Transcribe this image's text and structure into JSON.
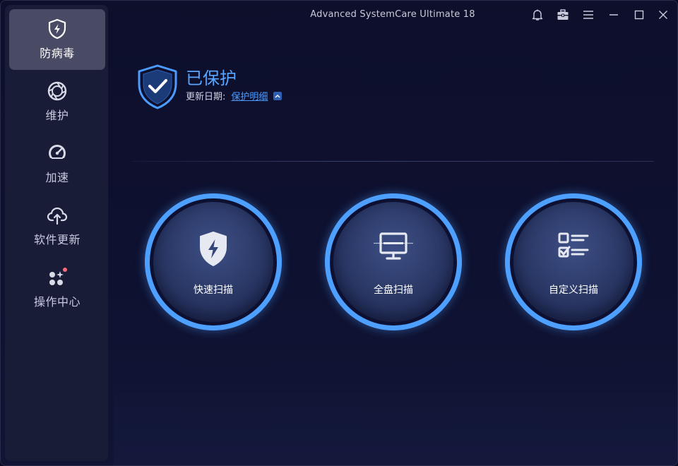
{
  "window": {
    "title": "Advanced SystemCare Ultimate  18"
  },
  "titlebar": {
    "buttons": [
      {
        "name": "bell-icon"
      },
      {
        "name": "toolbox-icon"
      },
      {
        "name": "menu-icon"
      },
      {
        "name": "minimize-icon"
      },
      {
        "name": "maximize-icon"
      },
      {
        "name": "close-icon"
      }
    ]
  },
  "sidebar": {
    "items": [
      {
        "label": "防病毒",
        "icon": "shield-bolt-icon",
        "active": true
      },
      {
        "label": "维护",
        "icon": "aperture-icon",
        "active": false
      },
      {
        "label": "加速",
        "icon": "speedometer-icon",
        "active": false
      },
      {
        "label": "软件更新",
        "icon": "cloud-upload-icon",
        "active": false
      },
      {
        "label": "操作中心",
        "icon": "apps-icon",
        "active": false,
        "badge": true
      }
    ]
  },
  "status": {
    "title": "已保护",
    "update_label": "更新日期:",
    "details_link": "保护明细"
  },
  "scans": [
    {
      "label": "快速扫描",
      "icon": "shield-bolt-icon"
    },
    {
      "label": "全盘扫描",
      "icon": "monitor-icon"
    },
    {
      "label": "自定义扫描",
      "icon": "checklist-icon"
    }
  ],
  "colors": {
    "accent": "#4da0ff",
    "background": "#0d0f2b",
    "sidebar": "#191c37",
    "active_item": "#484b63",
    "badge": "#ff6b7a"
  }
}
